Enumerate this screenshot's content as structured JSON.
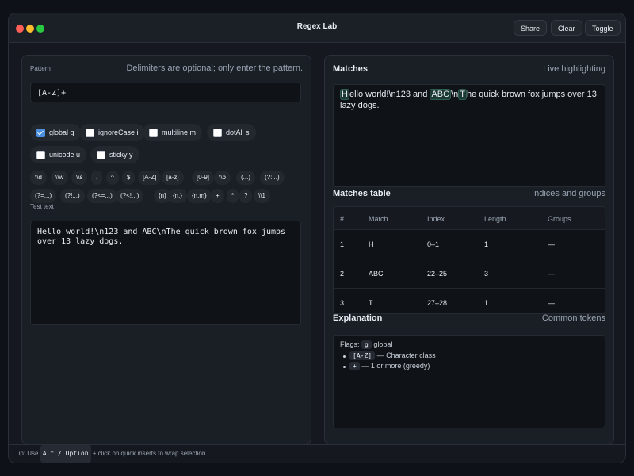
{
  "window": {
    "title": "Regex Lab"
  },
  "toolbar": {
    "share_label": "Share",
    "clear_label": "Clear",
    "toggle_label": "Toggle"
  },
  "pattern": {
    "label": "Pattern",
    "hint": "Delimiters are optional; only enter the pattern.",
    "value": "[A-Z]+"
  },
  "flags": [
    {
      "label": "global g",
      "checked": true
    },
    {
      "label": "ignoreCase i",
      "checked": false
    },
    {
      "label": "multiline m",
      "checked": false
    },
    {
      "label": "dotAll s",
      "checked": false
    },
    {
      "label": "unicode u",
      "checked": false
    },
    {
      "label": "sticky y",
      "checked": false
    }
  ],
  "tokens_row1": [
    "\\\\d",
    "\\\\w",
    "\\\\s",
    ".",
    "^",
    "$",
    "[A-Z]",
    "[a-z]",
    "[0-9]",
    "\\\\b",
    "(...)",
    "(?:...)"
  ],
  "tokens_row2": [
    "(?=...)",
    "(?!...)",
    "(?<=...)",
    "(?<!...)",
    "{n}",
    "{n,}",
    "{n,m}",
    "+",
    "*",
    "?",
    "\\\\1"
  ],
  "test": {
    "label": "Test text",
    "value": "Hello world!\\n123 and ABC\\nThe quick brown fox jumps over 13 lazy dogs."
  },
  "matches": {
    "title": "Matches",
    "hint": "Live highlighting",
    "segments": [
      {
        "text": "H",
        "hl": true
      },
      {
        "text": "ello world!\\n123 and ",
        "hl": false
      },
      {
        "text": "ABC",
        "hl": true
      },
      {
        "text": "\\n",
        "hl": false
      },
      {
        "text": "T",
        "hl": true
      },
      {
        "text": "he quick brown fox jumps over 13 lazy dogs.",
        "hl": false
      }
    ]
  },
  "table": {
    "title": "Matches table",
    "hint": "Indices and groups",
    "headers": [
      "#",
      "Match",
      "Index",
      "Length",
      "Groups"
    ],
    "rows": [
      [
        "1",
        "H",
        "0–1",
        "1",
        "—"
      ],
      [
        "2",
        "ABC",
        "22–25",
        "3",
        "—"
      ],
      [
        "3",
        "T",
        "27–28",
        "1",
        "—"
      ]
    ]
  },
  "explanation": {
    "title": "Explanation",
    "hint": "Common tokens",
    "flags_label": "Flags:",
    "flag_code": "g",
    "flag_name": "global",
    "items": [
      {
        "code": "[A-Z]",
        "desc": "— Character class"
      },
      {
        "code": "+",
        "desc": "— 1 or more (greedy)"
      }
    ]
  },
  "footer": {
    "prefix": "Tip: Use",
    "key": "Alt / Option",
    "suffix": "+ click on quick inserts to wrap selection."
  }
}
